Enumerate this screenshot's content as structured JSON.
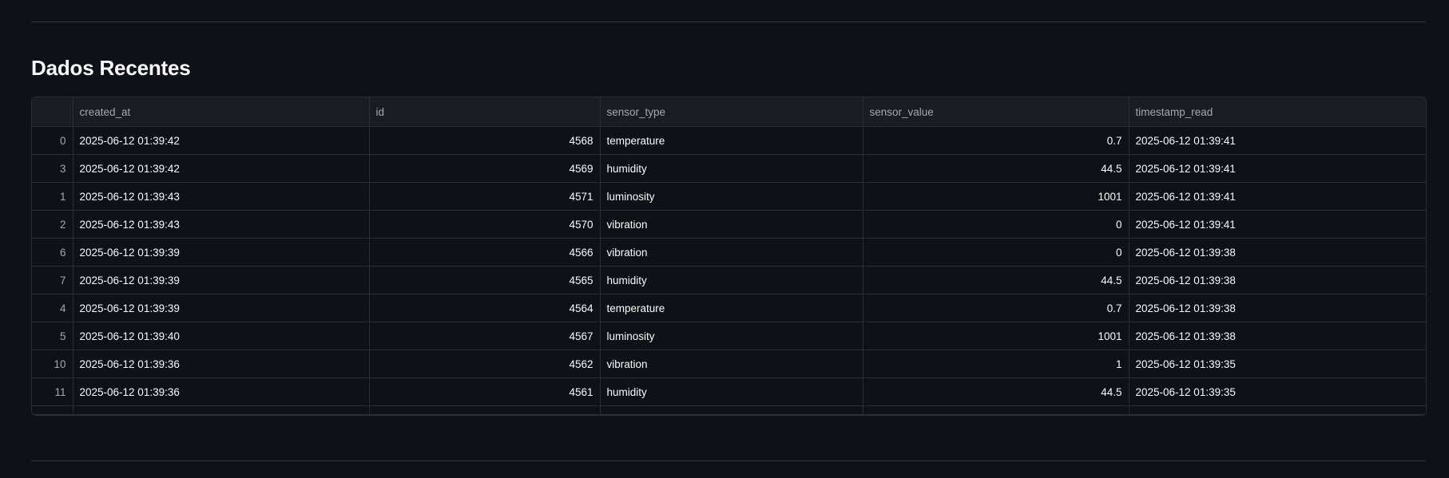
{
  "section": {
    "title": "Dados Recentes"
  },
  "table": {
    "columns": [
      "created_at",
      "id",
      "sensor_type",
      "sensor_value",
      "timestamp_read"
    ],
    "rows": [
      {
        "index": "0",
        "created_at": "2025-06-12 01:39:42",
        "id": "4568",
        "sensor_type": "temperature",
        "sensor_value": "0.7",
        "timestamp_read": "2025-06-12 01:39:41"
      },
      {
        "index": "3",
        "created_at": "2025-06-12 01:39:42",
        "id": "4569",
        "sensor_type": "humidity",
        "sensor_value": "44.5",
        "timestamp_read": "2025-06-12 01:39:41"
      },
      {
        "index": "1",
        "created_at": "2025-06-12 01:39:43",
        "id": "4571",
        "sensor_type": "luminosity",
        "sensor_value": "1001",
        "timestamp_read": "2025-06-12 01:39:41"
      },
      {
        "index": "2",
        "created_at": "2025-06-12 01:39:43",
        "id": "4570",
        "sensor_type": "vibration",
        "sensor_value": "0",
        "timestamp_read": "2025-06-12 01:39:41"
      },
      {
        "index": "6",
        "created_at": "2025-06-12 01:39:39",
        "id": "4566",
        "sensor_type": "vibration",
        "sensor_value": "0",
        "timestamp_read": "2025-06-12 01:39:38"
      },
      {
        "index": "7",
        "created_at": "2025-06-12 01:39:39",
        "id": "4565",
        "sensor_type": "humidity",
        "sensor_value": "44.5",
        "timestamp_read": "2025-06-12 01:39:38"
      },
      {
        "index": "4",
        "created_at": "2025-06-12 01:39:39",
        "id": "4564",
        "sensor_type": "temperature",
        "sensor_value": "0.7",
        "timestamp_read": "2025-06-12 01:39:38"
      },
      {
        "index": "5",
        "created_at": "2025-06-12 01:39:40",
        "id": "4567",
        "sensor_type": "luminosity",
        "sensor_value": "1001",
        "timestamp_read": "2025-06-12 01:39:38"
      },
      {
        "index": "10",
        "created_at": "2025-06-12 01:39:36",
        "id": "4562",
        "sensor_type": "vibration",
        "sensor_value": "1",
        "timestamp_read": "2025-06-12 01:39:35"
      },
      {
        "index": "11",
        "created_at": "2025-06-12 01:39:36",
        "id": "4561",
        "sensor_type": "humidity",
        "sensor_value": "44.5",
        "timestamp_read": "2025-06-12 01:39:35"
      }
    ]
  },
  "colors": {
    "background": "#0e1117",
    "header_bg": "#1a1c23",
    "border": "#2a2d35",
    "text": "#fafafa",
    "muted_text": "#a3a8b4"
  }
}
